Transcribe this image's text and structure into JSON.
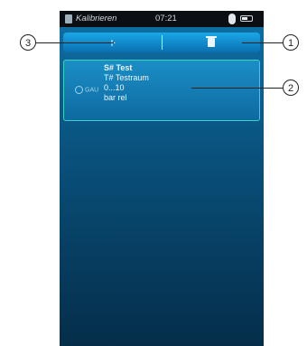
{
  "statusbar": {
    "title": "Kalibrieren",
    "time": "07:21"
  },
  "toolbar": {
    "add_label": "+",
    "delete_icon": "trash-icon"
  },
  "entry": {
    "gauge_label": "GAU",
    "line1": "S# Test",
    "line2": "T# Testraum",
    "line3": "0...10",
    "line4": "bar  rel"
  },
  "callouts": {
    "one": "1",
    "two": "2",
    "three": "3"
  }
}
